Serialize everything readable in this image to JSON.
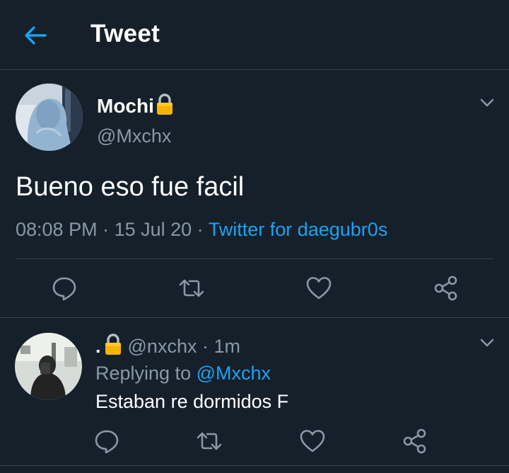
{
  "header": {
    "title": "Tweet",
    "back_icon": "arrow-left-icon",
    "accent": "#1da1f2"
  },
  "tweet": {
    "display_name": "Mochi",
    "lock_emoji": "🔒",
    "handle": "@Mxchx",
    "text": "Bueno eso fue facil",
    "time": "08:08 PM",
    "date": "15 Jul 20",
    "separator": " · ",
    "source": "Twitter for daegubr0s",
    "actions": [
      "reply-icon",
      "retweet-icon",
      "like-icon",
      "share-icon"
    ]
  },
  "reply": {
    "display_name": ".",
    "lock_emoji": "🔒",
    "handle": "@nxchx",
    "separator": " · ",
    "age": "1m",
    "replying_label": "Replying to",
    "replying_to": "@Mxchx",
    "text": "Estaban re dormidos F",
    "actions": [
      "reply-icon",
      "retweet-icon",
      "like-icon",
      "share-icon"
    ]
  },
  "colors": {
    "background": "#15202b",
    "divider": "#38444d",
    "secondary_text": "#8899a6",
    "link": "#1da1f2"
  }
}
